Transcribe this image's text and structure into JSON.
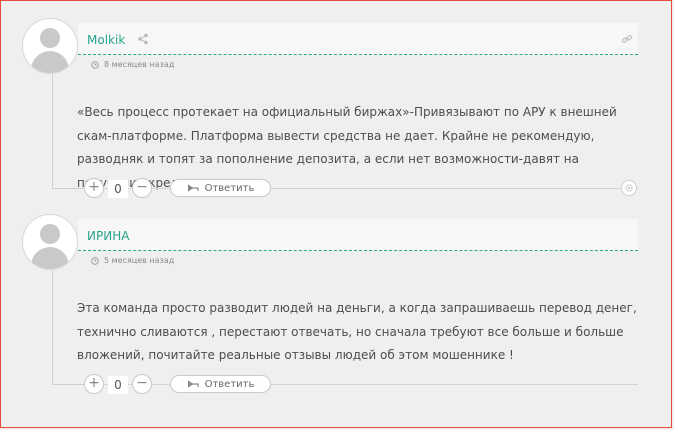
{
  "comments": [
    {
      "author": "Molkik",
      "time": "8 месяцев назад",
      "text": "«Весь процесс протекает на официальный биржах»-Привязывают по АРУ к внешней скам-платформе. Платформа вывести средства не дает. Крайне не рекомендую, разводняк и топят за пополнение депозита, а если нет возможности-давят на получение кредита.",
      "votes": "0",
      "reply_label": "Ответить",
      "vote_plus": "+",
      "vote_minus": "−"
    },
    {
      "author": "ИРИНА",
      "time": "5 месяцев назад",
      "text": "Эта команда просто разводит людей на деньги, а когда запрашиваешь перевод денег, технично сливаются , перестают отвечать, но сначала требуют все больше и больше вложений, почитайте реальные отзывы людей об этом мошеннике !",
      "votes": "0",
      "reply_label": "Ответить",
      "vote_plus": "+",
      "vote_minus": "−"
    }
  ],
  "icons": {
    "share": "share-icon",
    "link": "link-icon",
    "clock": "clock-icon",
    "reply": "reply-icon",
    "settings": "settings-icon"
  },
  "colors": {
    "author": "#27a58c",
    "border_red": "#e9493f",
    "background": "#efefef"
  }
}
